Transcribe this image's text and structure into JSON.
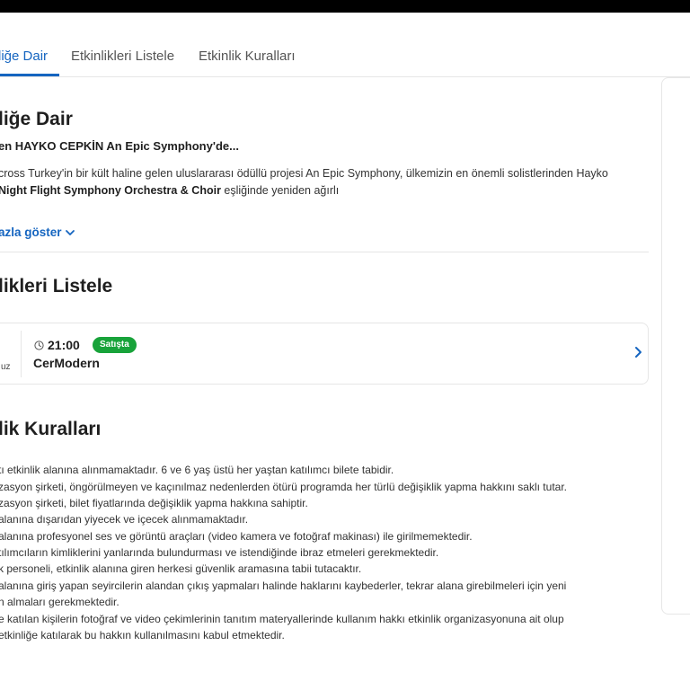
{
  "tabs": [
    {
      "label": "liğe Dair",
      "active": true
    },
    {
      "label": "Etkinlikleri Listele",
      "active": false
    },
    {
      "label": "Etkinlik Kuralları",
      "active": false
    }
  ],
  "about": {
    "heading": "liğe Dair",
    "subtitle": "en HAYKO CEPKİN An Epic Symphony'de...",
    "line1": "cross Turkey'in bir kült haline gelen uluslararası ödüllü projesi An Epic Symphony, ülkemizin en önemli solistlerinden Hayko",
    "line2_bold": "Night Flight Symphony Orchestra & Choir",
    "line2_rest": " eşliğinde yeniden ağırlı",
    "show_more": "azla göster"
  },
  "events": {
    "heading": "likleri Listele",
    "items": [
      {
        "date_top": "",
        "date_bottom": "uz",
        "time": "21:00",
        "status": "Satışta",
        "venue": "CerModern"
      }
    ]
  },
  "rules": {
    "heading": "lik Kuralları",
    "lines": [
      "tı etkinlik alanına alınmamaktadır. 6 ve 6 yaş üstü her yaştan katılımcı bilete tabidir.",
      "zasyon şirketi, öngörülmeyen ve kaçınılmaz nedenlerden ötürü programda her türlü değişiklik yapma hakkını saklı tutar.",
      "zasyon şirketi, bilet fiyatlarında değişiklik yapma hakkına sahiptir.",
      "alanına dışarıdan yiyecek ve içecek alınmamaktadır.",
      "alanına profesyonel ses ve görüntü araçları (video kamera ve fotoğraf makinası) ile girilmemektedir.",
      "tılımcıların kimliklerini yanlarında bulundurması ve istendiğinde ibraz etmeleri gerekmektedir.",
      "k personeli, etkinlik alanına giren herkesi güvenlik aramasına tabii tutacaktır.",
      "alanına giriş yapan seyircilerin alandan çıkış yapmaları halinde haklarını kaybederler, tekrar alana girebilmeleri için yeni",
      "n almaları gerekmektedir.",
      "e katılan kişilerin fotoğraf ve video çekimlerinin tanıtım materyallerinde kullanım hakkı etkinlik organizasyonuna ait olup",
      "etkinliğe katılarak bu hakkın kullanılmasını kabul etmektedir."
    ]
  },
  "colors": {
    "accent": "#1565c0",
    "status_green": "#18a33a",
    "topbar": "#000000"
  }
}
